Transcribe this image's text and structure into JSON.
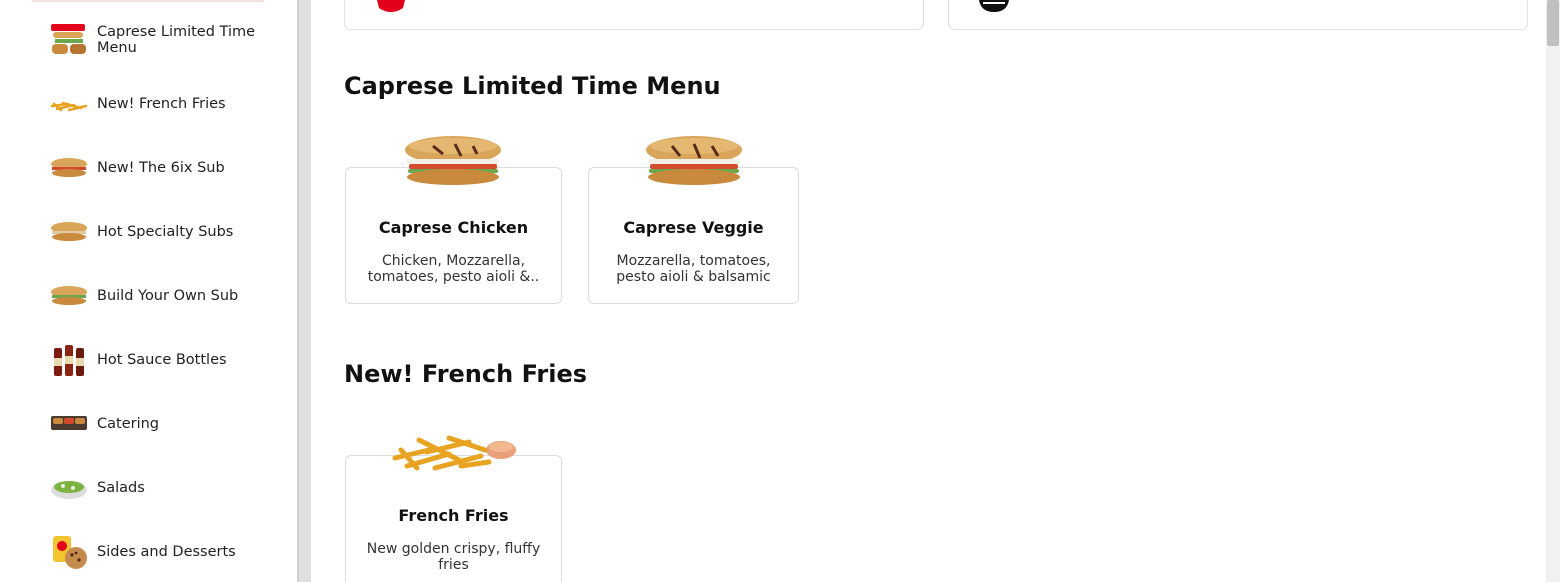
{
  "sidebar": {
    "items": [
      {
        "label": "Caprese Limited Time Menu",
        "icon": "caprese-logo-icon"
      },
      {
        "label": "New! French Fries",
        "icon": "fries-icon"
      },
      {
        "label": "New! The 6ix Sub",
        "icon": "sub-icon"
      },
      {
        "label": "Hot Specialty Subs",
        "icon": "sub-icon"
      },
      {
        "label": "Build Your Own Sub",
        "icon": "sub-icon"
      },
      {
        "label": "Hot Sauce Bottles",
        "icon": "hot-sauce-bottles-icon"
      },
      {
        "label": "Catering",
        "icon": "catering-tray-icon"
      },
      {
        "label": "Salads",
        "icon": "salad-bowl-icon"
      },
      {
        "label": "Sides and Desserts",
        "icon": "chips-cookie-icon"
      }
    ]
  },
  "sections": [
    {
      "title": "Caprese Limited Time Menu",
      "items": [
        {
          "name": "Caprese Chicken",
          "desc": "Chicken, Mozzarella, tomatoes, pesto aioli &.."
        },
        {
          "name": "Caprese Veggie",
          "desc": "Mozzarella, tomatoes, pesto aioli & balsamic"
        }
      ]
    },
    {
      "title": "New! French Fries",
      "items": [
        {
          "name": "French Fries",
          "desc": "New golden crispy, fluffy fries"
        }
      ]
    }
  ],
  "colors": {
    "brand_red": "#e3001b",
    "border": "#dcdcdc",
    "scrollbar_thumb": "#c1c1c1"
  }
}
